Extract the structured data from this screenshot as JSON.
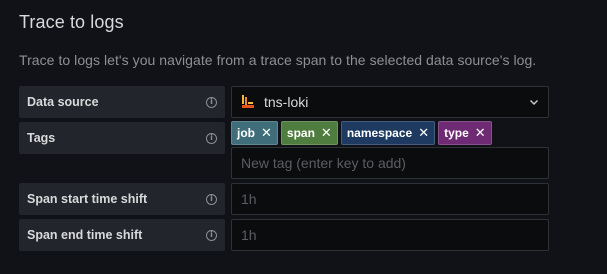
{
  "title": "Trace to logs",
  "description": "Trace to logs let's you navigate from a trace span to the selected data source's log.",
  "colors": {
    "background": "#111217",
    "label_bg": "#22252b",
    "field_bg": "#0b0c0e",
    "field_border": "#2c3235"
  },
  "data_source": {
    "label": "Data source",
    "value": "tns-loki",
    "icon": "loki-logo-icon"
  },
  "tags": {
    "label": "Tags",
    "items": [
      {
        "name": "job",
        "color": "#3f6e7a"
      },
      {
        "name": "span",
        "color": "#4f7c3f"
      },
      {
        "name": "namespace",
        "color": "#1f3a60"
      },
      {
        "name": "type",
        "color": "#6e2a73"
      }
    ],
    "placeholder": "New tag (enter key to add)"
  },
  "span_start": {
    "label": "Span start time shift",
    "placeholder": "1h"
  },
  "span_end": {
    "label": "Span end time shift",
    "placeholder": "1h"
  }
}
